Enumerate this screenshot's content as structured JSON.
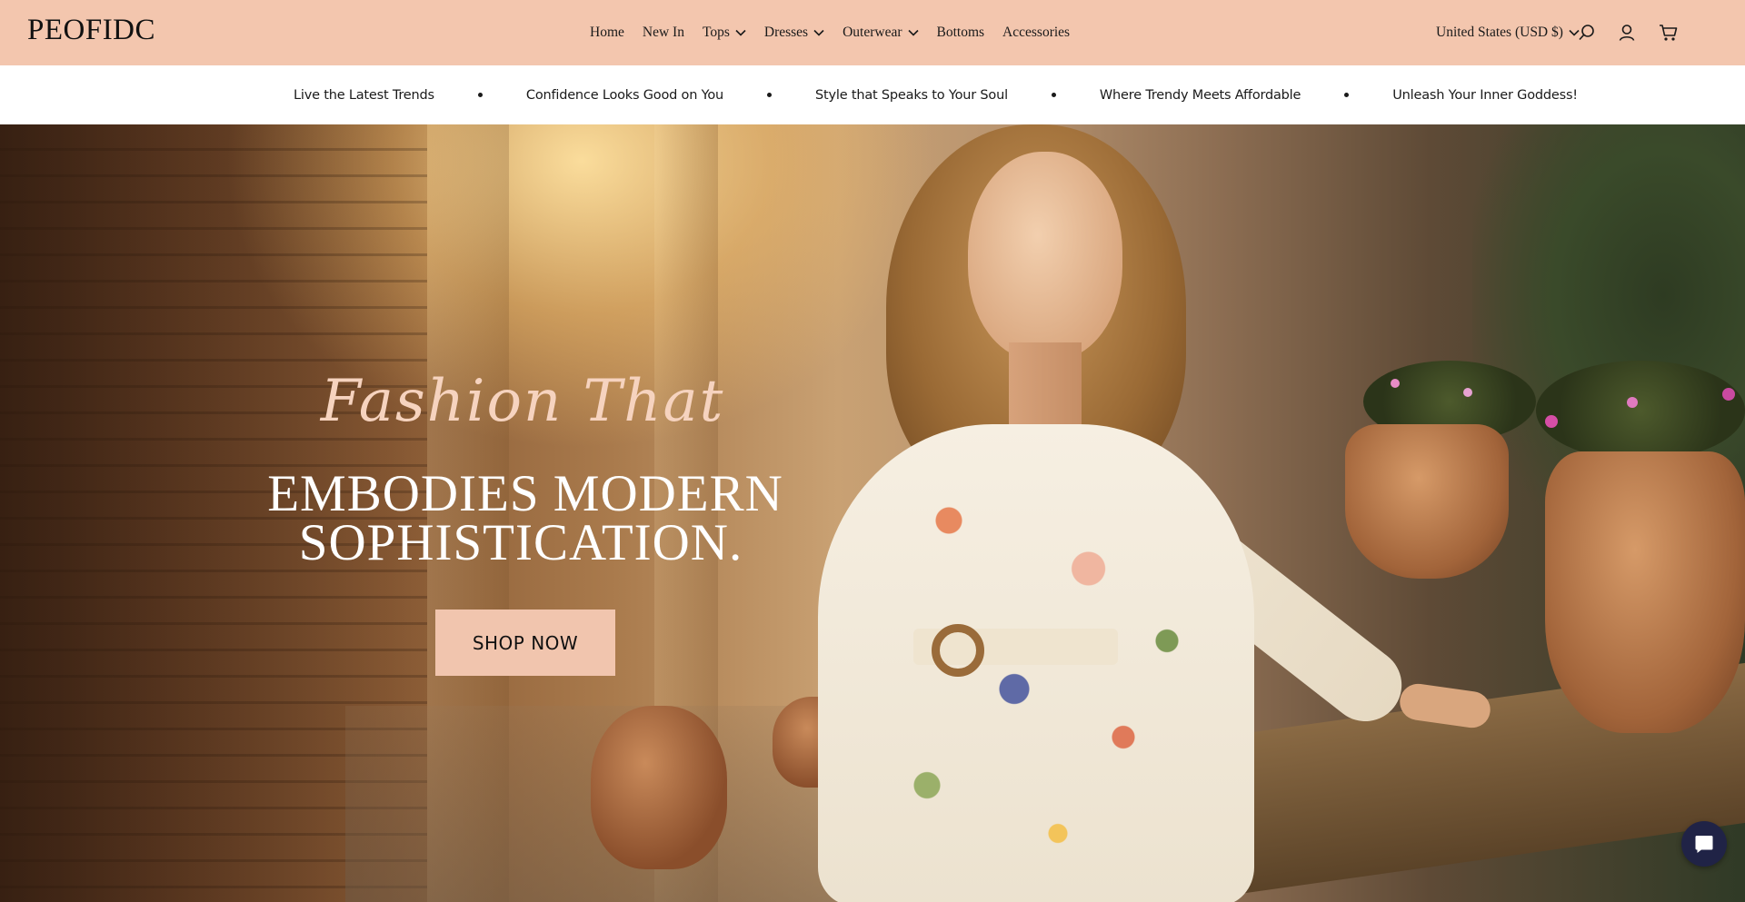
{
  "brand": {
    "logo_text": "PEOFIDC"
  },
  "nav": {
    "items": [
      {
        "label": "Home",
        "has_dropdown": false
      },
      {
        "label": "New In",
        "has_dropdown": false
      },
      {
        "label": "Tops",
        "has_dropdown": true
      },
      {
        "label": "Dresses",
        "has_dropdown": true
      },
      {
        "label": "Outerwear",
        "has_dropdown": true
      },
      {
        "label": "Bottoms",
        "has_dropdown": false
      },
      {
        "label": "Accessories",
        "has_dropdown": false
      }
    ],
    "currency_label": "United States (USD $)",
    "icons": [
      "search-icon",
      "account-icon",
      "cart-icon"
    ]
  },
  "announcement": {
    "slogans": [
      "Live the Latest Trends",
      "Confidence Looks Good on You",
      "Style that Speaks to Your Soul",
      "Where Trendy Meets Affordable",
      "Unleash Your Inner Goddess!"
    ]
  },
  "hero": {
    "script_title": "Fashion That",
    "headline_line1": "EMBODIES MODERN",
    "headline_line2": "SOPHISTICATION.",
    "cta_label": "SHOP NOW"
  },
  "chat": {
    "icon": "chat-icon"
  },
  "colors": {
    "header_bg": "#f3c6ae",
    "cta_bg": "#f1c5ae",
    "script_text": "#f6d3bf",
    "chat_bg": "#202346"
  }
}
